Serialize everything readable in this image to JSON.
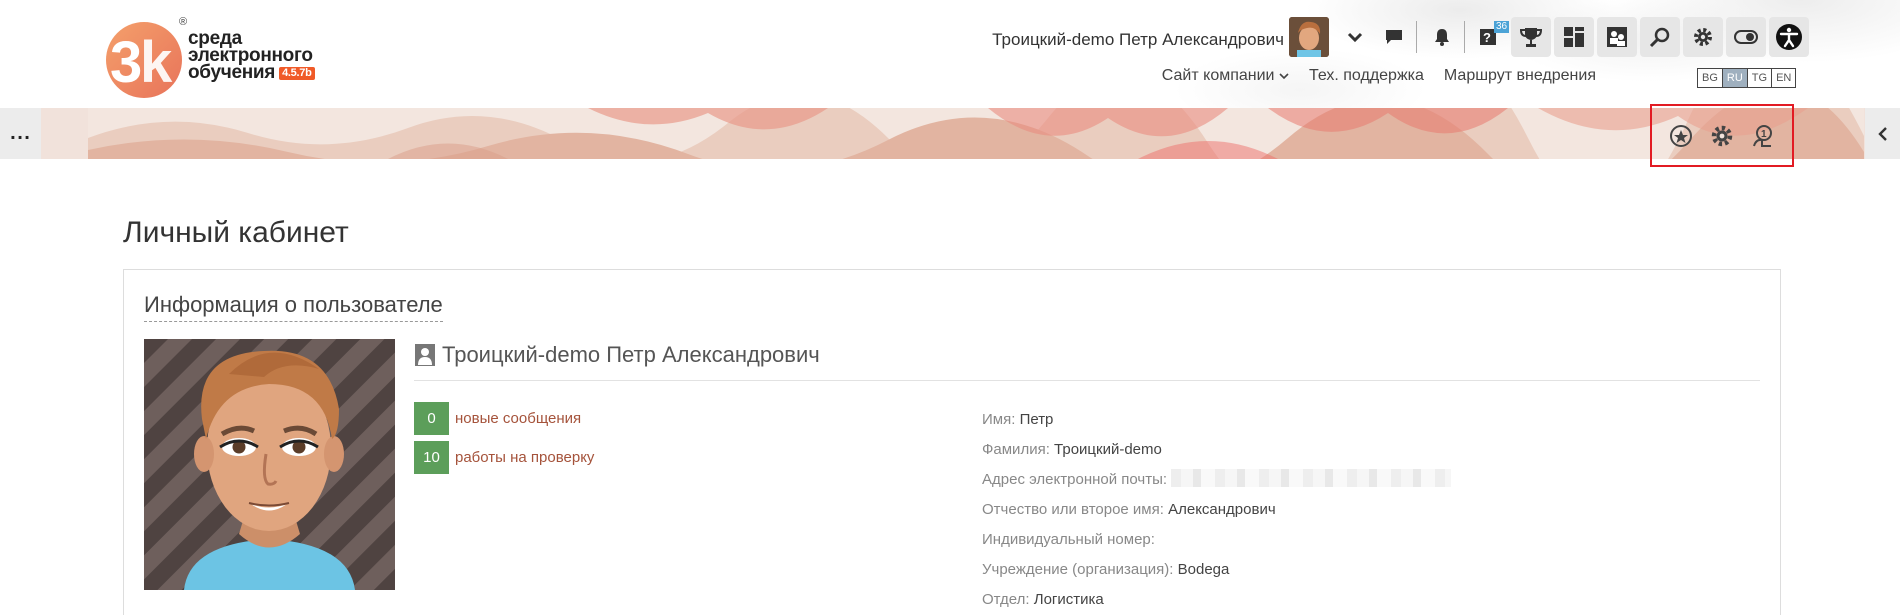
{
  "header": {
    "logo": {
      "reg": "®",
      "line1": "среда",
      "line2": "электронного",
      "line3": "обучения",
      "version": "4.5.7b"
    },
    "user_name": "Троицкий-demo Петр Александрович",
    "icons": [
      "user-menu-chevron-icon",
      "messages-icon",
      "notifications-icon",
      "help-icon",
      "achievements-icon",
      "dashboard-icon",
      "people-icon",
      "search-icon",
      "settings-icon",
      "toggle-icon",
      "accessibility-icon"
    ],
    "help_badge": "36",
    "links": {
      "company_site": "Сайт компании",
      "support": "Тех. поддержка",
      "route": "Маршрут внедрения"
    },
    "languages": [
      {
        "code": "BG",
        "active": false
      },
      {
        "code": "RU",
        "active": true
      },
      {
        "code": "TG",
        "active": false
      },
      {
        "code": "EN",
        "active": false
      }
    ]
  },
  "banner": {
    "left_toggle": "...",
    "tools": [
      "favorite-star-icon",
      "gear-icon",
      "user-help-icon"
    ],
    "highlight_color": "#e21b23"
  },
  "page": {
    "title": "Личный кабинет"
  },
  "card": {
    "title": "Информация о пользователе",
    "profile_name": "Троицкий-demo Петр Александрович",
    "stats": [
      {
        "count": "0",
        "label": "новые сообщения"
      },
      {
        "count": "10",
        "label": "работы на проверку"
      }
    ],
    "fields": [
      {
        "key": "Имя:",
        "value": "Петр"
      },
      {
        "key": "Фамилия:",
        "value": "Троицкий-demo"
      },
      {
        "key": "Адрес электронной почты:",
        "value": ""
      },
      {
        "key": "Отчество или второе имя:",
        "value": "Александрович"
      },
      {
        "key": "Индивидуальный номер:",
        "value": ""
      },
      {
        "key": "Учреждение (организация):",
        "value": "Bodega"
      },
      {
        "key": "Отдел:",
        "value": "Логистика"
      }
    ]
  },
  "colors": {
    "accent_green": "#5c9e5a",
    "link_brown": "#a5533b",
    "logo_orange": "#f05a28"
  }
}
